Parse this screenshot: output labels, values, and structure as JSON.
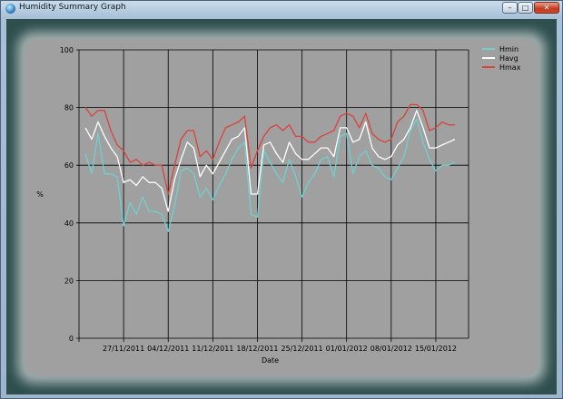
{
  "window": {
    "title": "Humidity Summary Graph",
    "icon": "app-icon",
    "controls": {
      "minimize": "minimize-icon",
      "maximize": "maximize-icon",
      "close": "close-icon"
    }
  },
  "colors": {
    "frame": "#2f4f4f",
    "plot_background": "#a0a0a0",
    "grid": "#000000",
    "hmin": "#6fd0cf",
    "havg": "#ffffff",
    "hmax": "#d9433b"
  },
  "chart_data": {
    "type": "line",
    "title": "",
    "xlabel": "Date",
    "ylabel": "%",
    "ylim": [
      0,
      100
    ],
    "yticks": [
      0,
      20,
      40,
      60,
      80,
      100
    ],
    "xlim": [
      "2011-11-20",
      "2012-01-19"
    ],
    "xticks": [
      "27/11/2011",
      "04/12/2011",
      "11/12/2011",
      "18/12/2011",
      "25/12/2011",
      "01/01/2012",
      "08/01/2012",
      "15/01/2012"
    ],
    "grid": true,
    "legend": "top-right",
    "x": [
      "2011-11-21",
      "2011-11-22",
      "2011-11-23",
      "2011-11-24",
      "2011-11-25",
      "2011-11-26",
      "2011-11-27",
      "2011-11-28",
      "2011-11-29",
      "2011-11-30",
      "2011-12-01",
      "2011-12-02",
      "2011-12-03",
      "2011-12-04",
      "2011-12-05",
      "2011-12-06",
      "2011-12-07",
      "2011-12-08",
      "2011-12-09",
      "2011-12-10",
      "2011-12-11",
      "2011-12-12",
      "2011-12-13",
      "2011-12-14",
      "2011-12-15",
      "2011-12-16",
      "2011-12-17",
      "2011-12-18",
      "2011-12-19",
      "2011-12-20",
      "2011-12-21",
      "2011-12-22",
      "2011-12-23",
      "2011-12-24",
      "2011-12-25",
      "2011-12-26",
      "2011-12-27",
      "2011-12-28",
      "2011-12-29",
      "2011-12-30",
      "2011-12-31",
      "2012-01-01",
      "2012-01-02",
      "2012-01-03",
      "2012-01-04",
      "2012-01-05",
      "2012-01-06",
      "2012-01-07",
      "2012-01-08",
      "2012-01-09",
      "2012-01-10",
      "2012-01-11",
      "2012-01-12",
      "2012-01-13",
      "2012-01-14",
      "2012-01-15",
      "2012-01-16",
      "2012-01-17",
      "2012-01-18"
    ],
    "series": [
      {
        "name": "Hmin",
        "color": "#6fd0cf",
        "values": [
          64,
          57,
          71,
          57,
          57,
          56,
          39,
          47,
          43,
          49,
          44,
          44,
          43,
          37,
          46,
          58,
          59,
          57,
          49,
          52,
          48,
          53,
          57,
          62,
          66,
          68,
          43,
          42,
          65,
          61,
          57,
          54,
          62,
          56,
          49,
          54,
          57,
          62,
          63,
          56,
          70,
          71,
          57,
          63,
          65,
          60,
          59,
          56,
          55,
          59,
          63,
          72,
          76,
          68,
          62,
          58,
          60,
          60,
          61
        ]
      },
      {
        "name": "Havg",
        "color": "#ffffff",
        "values": [
          73,
          69,
          75,
          70,
          66,
          63,
          54,
          55,
          53,
          56,
          54,
          54,
          52,
          44,
          55,
          62,
          68,
          66,
          56,
          60,
          57,
          61,
          65,
          69,
          70,
          73,
          50,
          50,
          67,
          68,
          64,
          61,
          68,
          64,
          62,
          62,
          64,
          66,
          66,
          63,
          73,
          73,
          68,
          69,
          75,
          66,
          63,
          62,
          63,
          67,
          69,
          73,
          79,
          73,
          66,
          66,
          67,
          68,
          69
        ]
      },
      {
        "name": "Hmax",
        "color": "#d9433b",
        "values": [
          80,
          77,
          79,
          79,
          72,
          67,
          65,
          61,
          62,
          60,
          61,
          60,
          60,
          50,
          60,
          69,
          72,
          72,
          63,
          65,
          62,
          68,
          73,
          74,
          75,
          77,
          59,
          65,
          70,
          73,
          74,
          72,
          74,
          70,
          70,
          68,
          68,
          70,
          71,
          72,
          77,
          78,
          77,
          73,
          78,
          71,
          69,
          68,
          69,
          75,
          77,
          81,
          81,
          79,
          72,
          73,
          75,
          74,
          74
        ]
      }
    ]
  }
}
